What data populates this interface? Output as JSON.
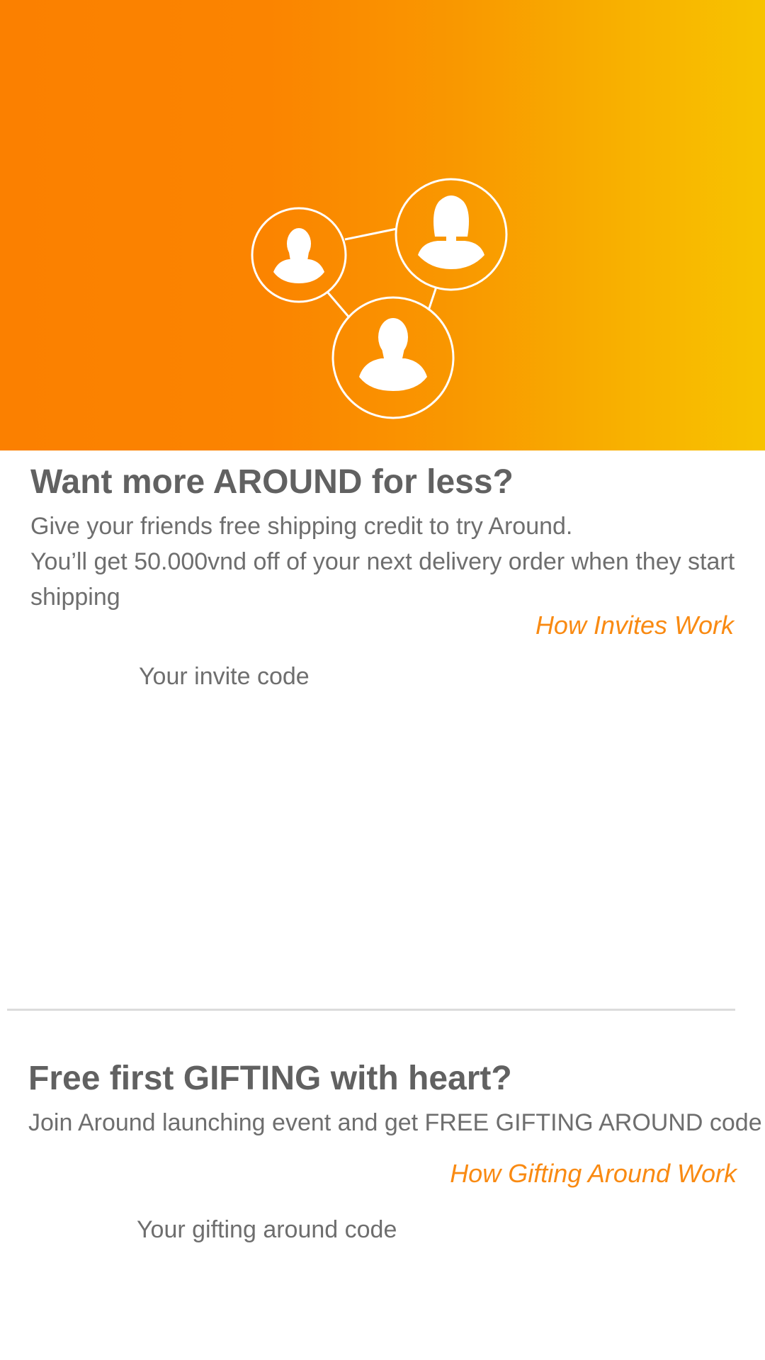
{
  "colors": {
    "hero_gradient_start": "#fb8000",
    "hero_gradient_end": "#f7c300",
    "heading_text": "#616161",
    "body_text": "#6e6e6e",
    "link_accent": "#f98a12",
    "divider": "#dcdcdc"
  },
  "hero": {
    "icons": [
      "user-male-icon",
      "user-female-icon",
      "user-male-icon"
    ]
  },
  "invite": {
    "title": "Want more AROUND for less?",
    "line1": "Give your friends free shipping credit to try Around.",
    "line2": "You’ll get 50.000vnd off of your next delivery order when they start shipping",
    "link_label": "How Invites Work",
    "code_label": "Your invite code"
  },
  "gifting": {
    "title": "Free first GIFTING with heart?",
    "description": "Join Around launching event and get FREE GIFTING AROUND code",
    "link_label": "How Gifting Around Work",
    "code_label": "Your gifting around code"
  }
}
